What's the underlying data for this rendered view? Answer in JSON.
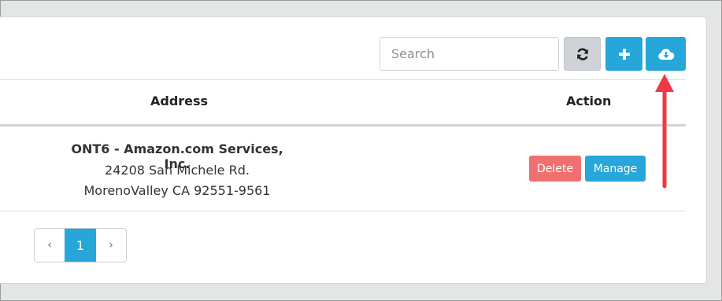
{
  "toolbar": {
    "search_placeholder": "Search",
    "refresh_icon": "refresh-icon",
    "add_icon": "plus-icon",
    "download_icon": "cloud-download-icon"
  },
  "table": {
    "columns": [
      "Address",
      "Action"
    ],
    "rows": [
      {
        "address_name": "ONT6 - Amazon.com Services, Inc.",
        "address_street": "24208 San Michele Rd.",
        "address_city": "MorenoValley CA 92551-9561",
        "actions": [
          "Delete",
          "Manage"
        ]
      }
    ]
  },
  "pagination": {
    "prev": "‹",
    "current": "1",
    "next": "›"
  },
  "annotation": {
    "color": "#ee3a43"
  },
  "colors": {
    "primary": "#26a6d9",
    "danger": "#f07070",
    "default": "#cfd2d6"
  }
}
